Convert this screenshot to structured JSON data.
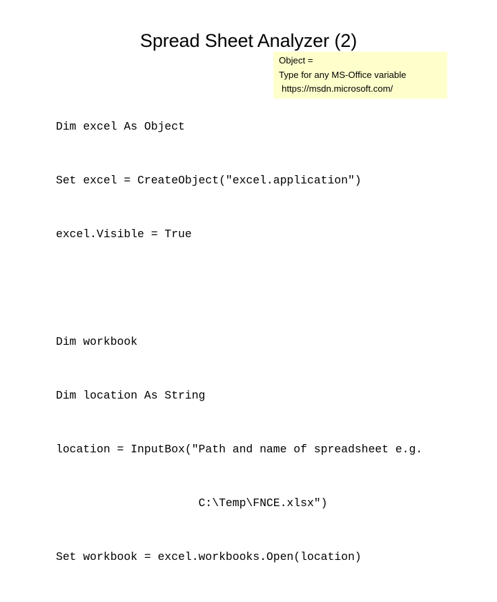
{
  "slide": {
    "title": "Spread Sheet Analyzer (2)",
    "background_color": "#FFFFFF",
    "text_color": "#000000"
  },
  "code": {
    "language": "VBA",
    "lines": [
      "Dim excel As Object",
      "Set excel = CreateObject(\"excel.application\")",
      "excel.Visible = True",
      "",
      "Dim workbook",
      "Dim location As String",
      "location = InputBox(\"Path and name of spreadsheet e.g.",
      "                     C:\\Temp\\FNCE.xlsx\")",
      "Set workbook = excel.workbooks.Open(location)"
    ]
  },
  "callout": {
    "background_color": "#FFFFCC",
    "lines": [
      "Object =",
      "Type for any MS-Office variable",
      "https://msdn.microsoft.com/"
    ]
  }
}
